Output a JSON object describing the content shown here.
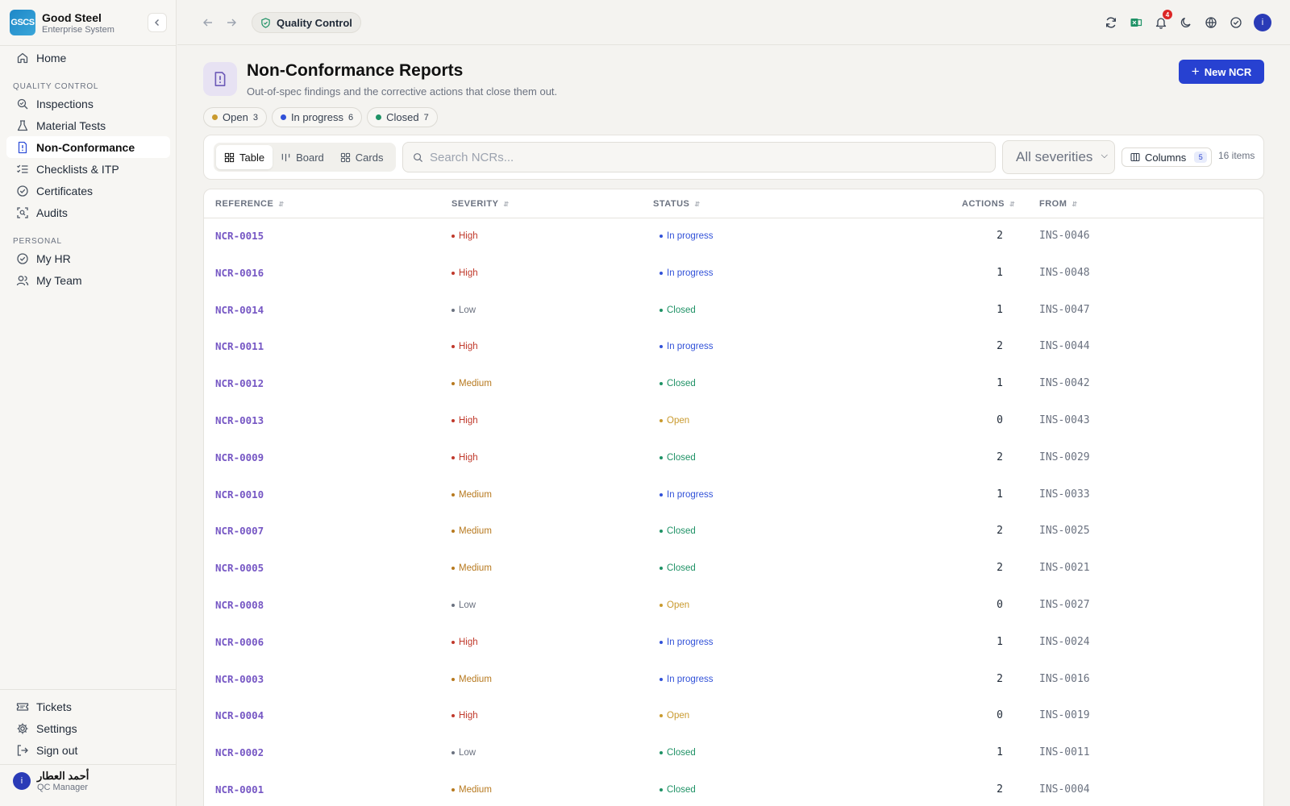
{
  "brand": {
    "logo_text": "GSCS",
    "name": "Good Steel",
    "subtitle": "Enterprise System"
  },
  "sidebar": {
    "home": "Home",
    "sections": [
      {
        "title": "QUALITY CONTROL",
        "items": [
          {
            "label": "Inspections",
            "icon": "inspection-search-icon"
          },
          {
            "label": "Material Tests",
            "icon": "flask-icon"
          },
          {
            "label": "Non-Conformance",
            "icon": "alert-file-icon",
            "active": true
          },
          {
            "label": "Checklists & ITP",
            "icon": "checklist-icon"
          },
          {
            "label": "Certificates",
            "icon": "certificate-check-icon"
          },
          {
            "label": "Audits",
            "icon": "audit-scan-icon"
          }
        ]
      },
      {
        "title": "PERSONAL",
        "items": [
          {
            "label": "My HR",
            "icon": "check-circle-icon"
          },
          {
            "label": "My Team",
            "icon": "users-icon"
          }
        ]
      }
    ],
    "bottom": [
      {
        "label": "Tickets",
        "icon": "ticket-icon"
      },
      {
        "label": "Settings",
        "icon": "gear-icon"
      },
      {
        "label": "Sign out",
        "icon": "sign-out-icon"
      }
    ],
    "user": {
      "avatar": "i",
      "name": "أحمد العطار",
      "role": "QC Manager"
    }
  },
  "topbar": {
    "breadcrumb": "Quality Control",
    "notification_count": "4",
    "avatar": "i"
  },
  "page": {
    "title": "Non-Conformance Reports",
    "subtitle": "Out-of-spec findings and the corrective actions that close them out.",
    "new_button": "New NCR"
  },
  "status_chips": [
    {
      "label": "Open",
      "count": "3",
      "color": "#c99a2e"
    },
    {
      "label": "In progress",
      "count": "6",
      "color": "#3151d8"
    },
    {
      "label": "Closed",
      "count": "7",
      "color": "#1f9266"
    }
  ],
  "toolbar": {
    "views": [
      "Table",
      "Board",
      "Cards"
    ],
    "active_view": "Table",
    "search_placeholder": "Search NCRs...",
    "severity_filter": "All severities",
    "columns_label": "Columns",
    "columns_count": "5",
    "item_count": "16 items"
  },
  "table": {
    "headers": [
      "REFERENCE",
      "SEVERITY",
      "STATUS",
      "ACTIONS",
      "FROM"
    ],
    "rows": [
      {
        "ref": "NCR-0015",
        "severity": "High",
        "status": "In progress",
        "actions": "2",
        "from": "INS-0046"
      },
      {
        "ref": "NCR-0016",
        "severity": "High",
        "status": "In progress",
        "actions": "1",
        "from": "INS-0048"
      },
      {
        "ref": "NCR-0014",
        "severity": "Low",
        "status": "Closed",
        "actions": "1",
        "from": "INS-0047"
      },
      {
        "ref": "NCR-0011",
        "severity": "High",
        "status": "In progress",
        "actions": "2",
        "from": "INS-0044"
      },
      {
        "ref": "NCR-0012",
        "severity": "Medium",
        "status": "Closed",
        "actions": "1",
        "from": "INS-0042"
      },
      {
        "ref": "NCR-0013",
        "severity": "High",
        "status": "Open",
        "actions": "0",
        "from": "INS-0043"
      },
      {
        "ref": "NCR-0009",
        "severity": "High",
        "status": "Closed",
        "actions": "2",
        "from": "INS-0029"
      },
      {
        "ref": "NCR-0010",
        "severity": "Medium",
        "status": "In progress",
        "actions": "1",
        "from": "INS-0033"
      },
      {
        "ref": "NCR-0007",
        "severity": "Medium",
        "status": "Closed",
        "actions": "2",
        "from": "INS-0025"
      },
      {
        "ref": "NCR-0005",
        "severity": "Medium",
        "status": "Closed",
        "actions": "2",
        "from": "INS-0021"
      },
      {
        "ref": "NCR-0008",
        "severity": "Low",
        "status": "Open",
        "actions": "0",
        "from": "INS-0027"
      },
      {
        "ref": "NCR-0006",
        "severity": "High",
        "status": "In progress",
        "actions": "1",
        "from": "INS-0024"
      },
      {
        "ref": "NCR-0003",
        "severity": "Medium",
        "status": "In progress",
        "actions": "2",
        "from": "INS-0016"
      },
      {
        "ref": "NCR-0004",
        "severity": "High",
        "status": "Open",
        "actions": "0",
        "from": "INS-0019"
      },
      {
        "ref": "NCR-0002",
        "severity": "Low",
        "status": "Closed",
        "actions": "1",
        "from": "INS-0011"
      },
      {
        "ref": "NCR-0001",
        "severity": "Medium",
        "status": "Closed",
        "actions": "2",
        "from": "INS-0004"
      }
    ]
  },
  "colors": {
    "accent": "#2741d1",
    "reference": "#7657c4",
    "severity": {
      "High": "#c0392b",
      "Medium": "#b7791f",
      "Low": "#6b7280"
    },
    "status": {
      "In progress": "#3151d8",
      "Closed": "#1f9266",
      "Open": "#c99a2e"
    }
  }
}
